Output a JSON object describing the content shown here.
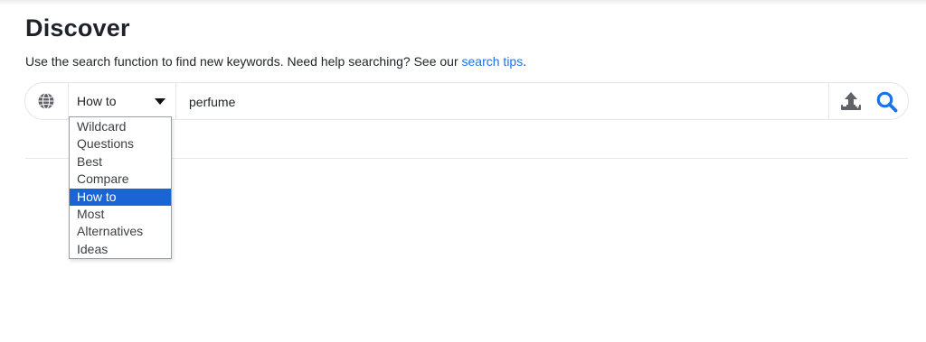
{
  "header": {
    "title": "Discover",
    "subtitle_text": "Use the search function to find new keywords. Need help searching? See our ",
    "subtitle_link": "search tips",
    "subtitle_end": "."
  },
  "search": {
    "mode_selected": "How to",
    "keyword_value": "perfume",
    "globe_icon": "globe-icon",
    "upload_icon": "upload-icon",
    "search_icon": "magnifier-icon",
    "accent_color": "#1a73e8"
  },
  "dropdown": {
    "options": [
      "Wildcard",
      "Questions",
      "Best",
      "Compare",
      "How to",
      "Most",
      "Alternatives",
      "Ideas"
    ],
    "selected_index": 4,
    "highlight_color": "#1a64d6"
  }
}
